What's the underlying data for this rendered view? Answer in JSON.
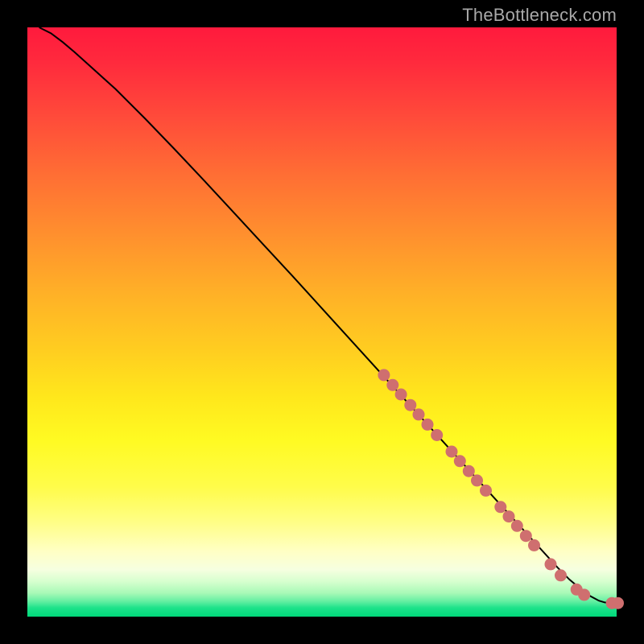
{
  "watermark": "TheBottleneck.com",
  "colors": {
    "background": "#000000",
    "curve": "#000000",
    "marker": "#cf6f6f"
  },
  "chart_data": {
    "type": "line",
    "title": "",
    "xlabel": "",
    "ylabel": "",
    "xlim": [
      0,
      100
    ],
    "ylim": [
      0,
      100
    ],
    "grid": false,
    "legend": false,
    "series": [
      {
        "name": "curve",
        "x": [
          2,
          4,
          6,
          8,
          10,
          15,
          20,
          25,
          30,
          35,
          40,
          45,
          50,
          55,
          60,
          65,
          70,
          75,
          80,
          85,
          90,
          92,
          94,
          95.5,
          97,
          98,
          99,
          100
        ],
        "y": [
          100,
          99,
          97.5,
          95.8,
          94,
          89.5,
          84.5,
          79.3,
          74,
          68.6,
          63.2,
          57.8,
          52.3,
          46.8,
          41.3,
          35.8,
          30.3,
          24.8,
          19.3,
          13.8,
          8.3,
          6.3,
          4.6,
          3.5,
          2.7,
          2.4,
          2.3,
          2.3
        ]
      }
    ],
    "markers": [
      {
        "x": 60.5,
        "y": 41.0
      },
      {
        "x": 62.0,
        "y": 39.3
      },
      {
        "x": 63.4,
        "y": 37.7
      },
      {
        "x": 65.0,
        "y": 35.9
      },
      {
        "x": 66.4,
        "y": 34.3
      },
      {
        "x": 67.9,
        "y": 32.6
      },
      {
        "x": 69.5,
        "y": 30.8
      },
      {
        "x": 72.0,
        "y": 28.0
      },
      {
        "x": 73.4,
        "y": 26.4
      },
      {
        "x": 74.9,
        "y": 24.7
      },
      {
        "x": 76.3,
        "y": 23.1
      },
      {
        "x": 77.8,
        "y": 21.4
      },
      {
        "x": 80.3,
        "y": 18.6
      },
      {
        "x": 81.7,
        "y": 17.0
      },
      {
        "x": 83.1,
        "y": 15.4
      },
      {
        "x": 84.6,
        "y": 13.7
      },
      {
        "x": 86.0,
        "y": 12.1
      },
      {
        "x": 88.8,
        "y": 8.9
      },
      {
        "x": 90.5,
        "y": 7.0
      },
      {
        "x": 93.2,
        "y": 4.6
      },
      {
        "x": 94.5,
        "y": 3.7
      },
      {
        "x": 99.2,
        "y": 2.3
      },
      {
        "x": 100.2,
        "y": 2.3
      }
    ],
    "background_gradient_stops": [
      {
        "pos": 0.0,
        "color": "#ff1a3d"
      },
      {
        "pos": 0.5,
        "color": "#ffce20"
      },
      {
        "pos": 0.7,
        "color": "#fffa22"
      },
      {
        "pos": 0.92,
        "color": "#f6ffe0"
      },
      {
        "pos": 1.0,
        "color": "#00d97a"
      }
    ]
  }
}
